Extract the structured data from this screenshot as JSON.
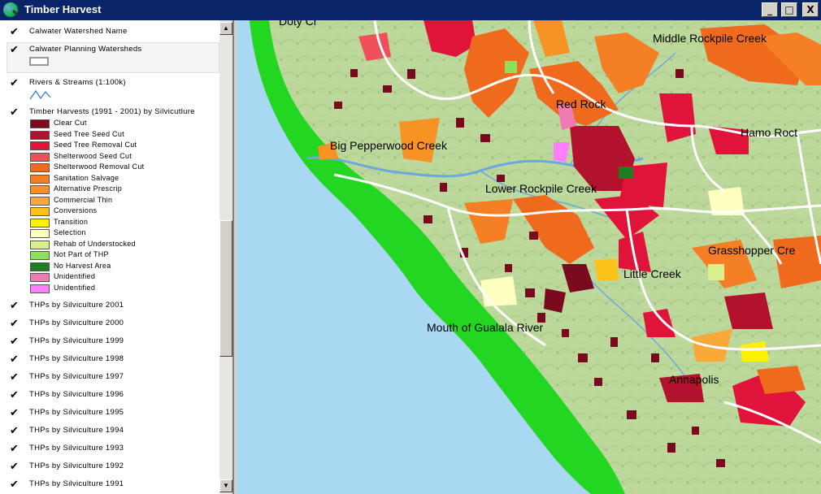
{
  "window": {
    "title": "Timber Harvest",
    "controls": [
      "_",
      "□",
      "X"
    ]
  },
  "toc": {
    "layers_top": [
      {
        "label": "Calwater Watershed Name",
        "checked": true
      },
      {
        "label": "Calwater Planning Watersheds",
        "checked": true
      },
      {
        "label": "Rivers & Streams (1:100k)",
        "checked": true
      },
      {
        "label": "Timber Harvests (1991 - 2001) by Silvicutlure",
        "checked": true
      }
    ],
    "legend": [
      {
        "label": "Clear Cut",
        "color": "#7a0a1e"
      },
      {
        "label": "Seed Tree Seed Cut",
        "color": "#b3122c"
      },
      {
        "label": "Seed Tree Removal Cut",
        "color": "#e0143a"
      },
      {
        "label": "Shelterwood Seed Cut",
        "color": "#f0505a"
      },
      {
        "label": "Shelterwood Removal Cut",
        "color": "#f06a1e"
      },
      {
        "label": "Sanitation Salvage",
        "color": "#f57f24"
      },
      {
        "label": "Alternative Prescrip",
        "color": "#f79224"
      },
      {
        "label": "Commercial Thin",
        "color": "#f9a83a"
      },
      {
        "label": "Conversions",
        "color": "#fcc21a"
      },
      {
        "label": "Transition",
        "color": "#fff200"
      },
      {
        "label": "Selection",
        "color": "#ffffc0"
      },
      {
        "label": "Rehab of Understocked",
        "color": "#d8f08c"
      },
      {
        "label": "Not Part of THP",
        "color": "#8ee05c"
      },
      {
        "label": "No Harvest Area",
        "color": "#1e7d1e"
      },
      {
        "label": "Unidentified",
        "color": "#f07ab4"
      },
      {
        "label": "Unidentified",
        "color": "#ff80ff"
      }
    ],
    "layers_bottom": [
      {
        "label": "THPs by Silviculture 2001",
        "checked": true
      },
      {
        "label": "THPs by Silviculture 2000",
        "checked": true
      },
      {
        "label": "THPs by Silviculture 1999",
        "checked": true
      },
      {
        "label": "THPs by Silviculture 1998",
        "checked": true
      },
      {
        "label": "THPs by Silviculture 1997",
        "checked": true
      },
      {
        "label": "THPs by Silviculture 1996",
        "checked": true
      },
      {
        "label": "THPs by Silviculture 1995",
        "checked": true
      },
      {
        "label": "THPs by Silviculture 1994",
        "checked": true
      },
      {
        "label": "THPs by Silviculture 1993",
        "checked": true
      },
      {
        "label": "THPs by Silviculture 1992",
        "checked": true
      },
      {
        "label": "THPs by Silviculture 1991",
        "checked": true
      }
    ]
  },
  "map": {
    "place_labels": [
      "Doty Cr",
      "Middle Rockpile Creek",
      "Red Rock",
      "Hamo Roct",
      "Big Pepperwood Creek",
      "Lower Rockpile Creek",
      "Grasshopper Cre",
      "Little Creek",
      "Mouth of Gualala River",
      "Annapolis"
    ],
    "colors": {
      "ocean": "#a9d8f2",
      "coastal_strip": "#22d622",
      "land": "#bcd79a"
    }
  }
}
